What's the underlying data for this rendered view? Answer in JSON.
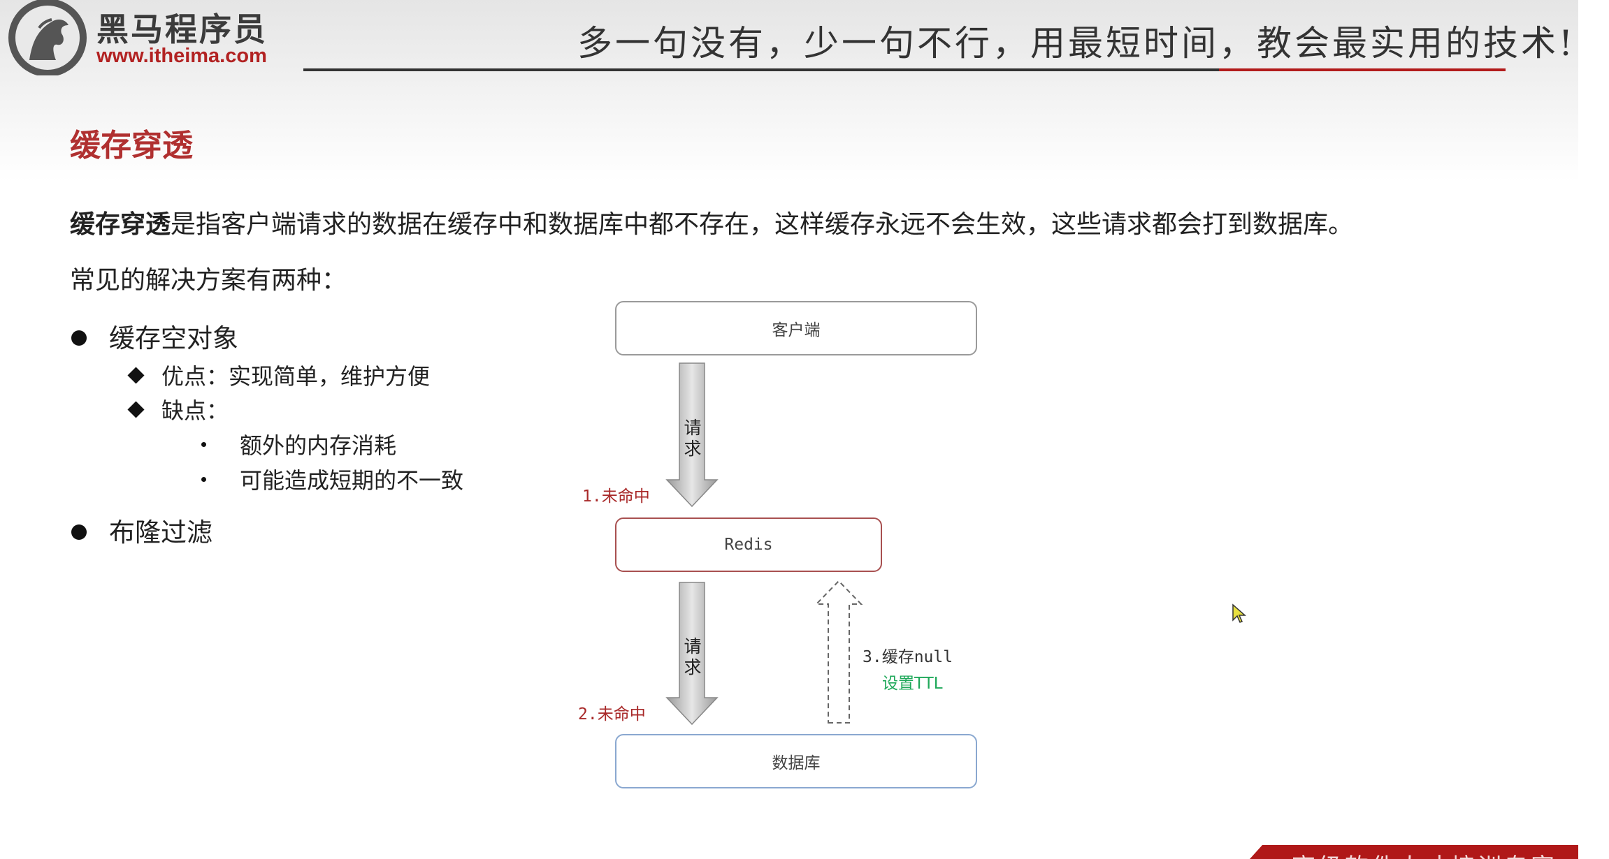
{
  "header": {
    "brand_name": "黑马程序员",
    "brand_url": "www.itheima.com",
    "slogan": "多一句没有，少一句不行，用最短时间，教会最实用的技术!"
  },
  "slide": {
    "title": "缓存穿透",
    "intro_term": "缓存穿透",
    "intro_rest": "是指客户端请求的数据在缓存中和数据库中都不存在，这样缓存永远不会生效，这些请求都会打到数据库。",
    "subhead": "常见的解决方案有两种：",
    "solutions": [
      {
        "label": "缓存空对象"
      },
      {
        "label": "布隆过滤"
      }
    ],
    "pros": "优点：实现简单，维护方便",
    "cons": "缺点：",
    "cons_items": [
      "额外的内存消耗",
      "可能造成短期的不一致"
    ]
  },
  "diagram": {
    "client": "客户端",
    "redis": "Redis",
    "database": "数据库",
    "request_label_1": "请求",
    "request_label_2": "请求",
    "miss_1": "1.未命中",
    "miss_2": "2.未命中",
    "cache_null": "3.缓存null",
    "set_ttl": "设置TTL"
  },
  "footer": {
    "banner_text": "高级软件人才培训专家"
  },
  "colors": {
    "accent_red": "#b03030",
    "ttl_green": "#1fa85a"
  }
}
